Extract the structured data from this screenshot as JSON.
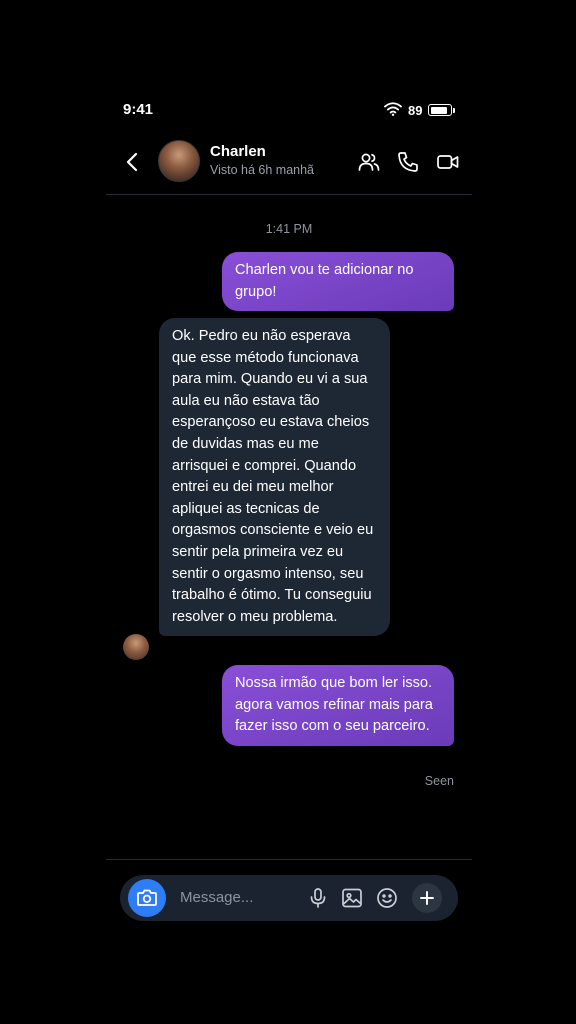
{
  "status_bar": {
    "time": "9:41",
    "battery": "89"
  },
  "header": {
    "name": "Charlen",
    "last_seen": "Visto há 6h manhã"
  },
  "timestamp": "1:41 PM",
  "messages": [
    {
      "direction": "outgoing",
      "text": "Charlen vou te adicionar no grupo!"
    },
    {
      "direction": "incoming",
      "text": "Ok. Pedro eu não esperava que esse método funcionava para mim. Quando eu vi a sua aula eu não estava tão esperançoso eu estava cheios de duvidas mas eu me arrisquei e comprei. Quando entrei eu dei meu melhor apliquei as tecnicas de orgasmos consciente e veio eu sentir pela primeira vez eu sentir o orgasmo intenso, seu trabalho é ótimo. Tu conseguiu resolver o meu problema."
    },
    {
      "direction": "outgoing",
      "text": "Nossa irmão que bom ler isso. agora vamos refinar mais para fazer isso com o seu parceiro."
    }
  ],
  "seen_label": "Seen",
  "composer": {
    "placeholder": "Message..."
  },
  "colors": {
    "outgoing_bubble": "#7a45c8",
    "incoming_bubble": "#1e2734",
    "camera_button": "#2f7df4"
  }
}
